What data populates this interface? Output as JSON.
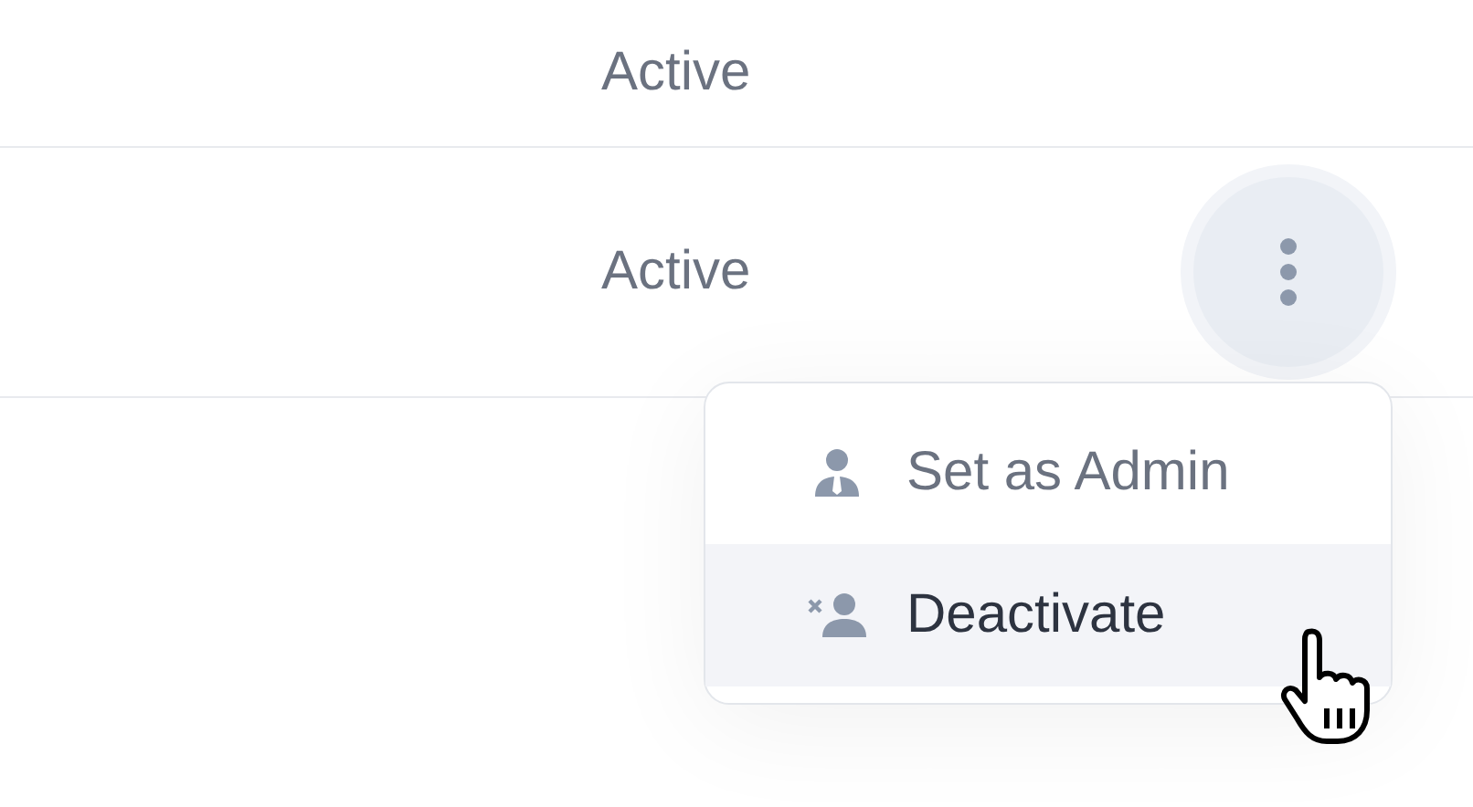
{
  "rows": [
    {
      "status": "Active",
      "menu_open": false
    },
    {
      "status": "Active",
      "menu_open": true
    }
  ],
  "menu": {
    "items": [
      {
        "kind": "admin",
        "label": "Set as Admin",
        "selected": false
      },
      {
        "kind": "deactivate",
        "label": "Deactivate",
        "selected": true
      }
    ]
  }
}
